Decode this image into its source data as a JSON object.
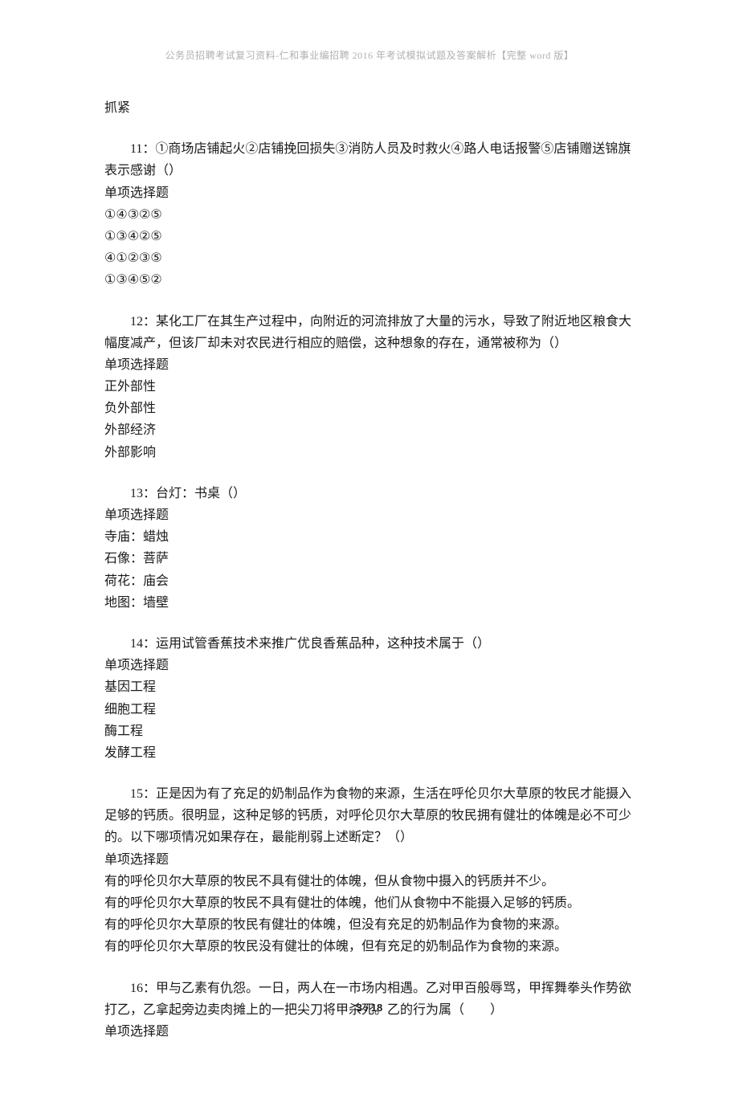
{
  "header": "公务员招聘考试复习资料-仁和事业编招聘 2016 年考试模拟试题及答案解析【完整 word 版】",
  "q10_trailing": "抓紧",
  "q11": {
    "stem": "11：①商场店铺起火②店铺挽回损失③消防人员及时救火④路人电话报警⑤店铺赠送锦旗表示感谢（）",
    "type": "单项选择题",
    "opts": [
      "①④③②⑤",
      "①③④②⑤",
      "④①②③⑤",
      "①③④⑤②"
    ]
  },
  "q12": {
    "stem": "12：某化工厂在其生产过程中，向附近的河流排放了大量的污水，导致了附近地区粮食大幅度减产，但该厂却未对农民进行相应的赔偿，这种想象的存在，通常被称为（）",
    "type": "单项选择题",
    "opts": [
      "正外部性",
      "负外部性",
      "外部经济",
      "外部影响"
    ]
  },
  "q13": {
    "stem": "13：台灯：书桌（）",
    "type": "单项选择题",
    "opts": [
      "寺庙：蜡烛",
      "石像：菩萨",
      "荷花：庙会",
      "地图：墙壁"
    ]
  },
  "q14": {
    "stem": "14：运用试管香蕉技术来推广优良香蕉品种，这种技术属于（）",
    "type": "单项选择题",
    "opts": [
      "基因工程",
      "细胞工程",
      "酶工程",
      "发酵工程"
    ]
  },
  "q15": {
    "stem": "15：正是因为有了充足的奶制品作为食物的来源，生活在呼伦贝尔大草原的牧民才能摄入足够的钙质。很明显，这种足够的钙质，对呼伦贝尔大草原的牧民拥有健壮的体魄是必不可少的。以下哪项情况如果存在，最能削弱上述断定？（）",
    "type": "单项选择题",
    "opts": [
      "有的呼伦贝尔大草原的牧民不具有健壮的体魄，但从食物中摄入的钙质并不少。",
      "有的呼伦贝尔大草原的牧民不具有健壮的体魄，他们从食物中不能摄入足够的钙质。",
      "有的呼伦贝尔大草原的牧民有健壮的体魄，但没有充足的奶制品作为食物的来源。",
      "有的呼伦贝尔大草原的牧民没有健壮的体魄，但有充足的奶制品作为食物的来源。"
    ]
  },
  "q16": {
    "stem": "16：甲与乙素有仇怨。一日，两人在一市场内相遇。乙对甲百般辱骂，甲挥舞拳头作势欲打乙，乙拿起旁边卖肉摊上的一把尖刀将甲杀死。乙的行为属（　　）",
    "type": "单项选择题"
  },
  "footer": {
    "page": "3",
    "total": "18",
    "sep": " / "
  }
}
